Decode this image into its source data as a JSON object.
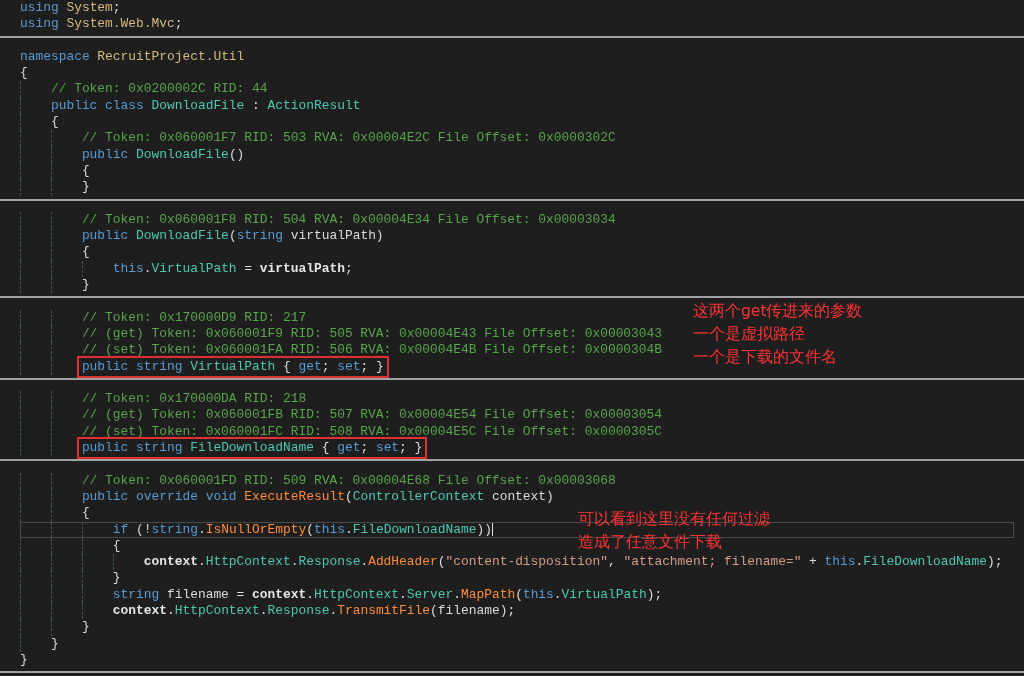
{
  "code_lines": [
    {
      "tokens": [
        {
          "text": "using",
          "kind": "keyword"
        },
        {
          "text": " System",
          "kind": "namespace"
        },
        {
          "text": ";",
          "kind": "plain"
        }
      ]
    },
    {
      "tokens": [
        {
          "text": "using",
          "kind": "keyword"
        },
        {
          "text": " System.Web.Mvc",
          "kind": "namespace"
        },
        {
          "text": ";",
          "kind": "plain"
        }
      ],
      "separator_after": true
    },
    {
      "tokens": [
        {
          "text": "namespace",
          "kind": "keyword"
        },
        {
          "text": " RecruitProject.Util",
          "kind": "namespace"
        }
      ]
    },
    {
      "tokens": [
        {
          "text": "{",
          "kind": "plain"
        }
      ]
    },
    {
      "tokens": [
        {
          "text": "    // Token: 0x0200002C RID: 44",
          "kind": "comment"
        }
      ]
    },
    {
      "tokens": [
        {
          "text": "    public class",
          "kind": "keyword"
        },
        {
          "text": " DownloadFile",
          "kind": "type"
        },
        {
          "text": " : ",
          "kind": "plain"
        },
        {
          "text": "ActionResult",
          "kind": "type"
        }
      ]
    },
    {
      "tokens": [
        {
          "text": "    {",
          "kind": "plain"
        }
      ]
    },
    {
      "tokens": [
        {
          "text": "        // Token: 0x060001F7 RID: 503 RVA: 0x00004E2C File Offset: 0x0000302C",
          "kind": "comment"
        }
      ]
    },
    {
      "tokens": [
        {
          "text": "        public",
          "kind": "keyword"
        },
        {
          "text": " DownloadFile",
          "kind": "type"
        },
        {
          "text": "()",
          "kind": "plain"
        }
      ]
    },
    {
      "tokens": [
        {
          "text": "        {",
          "kind": "plain"
        }
      ]
    },
    {
      "tokens": [
        {
          "text": "        }",
          "kind": "plain"
        }
      ],
      "separator_after": true
    },
    {
      "tokens": [
        {
          "text": "        // Token: 0x060001F8 RID: 504 RVA: 0x00004E34 File Offset: 0x00003034",
          "kind": "comment"
        }
      ]
    },
    {
      "tokens": [
        {
          "text": "        public",
          "kind": "keyword"
        },
        {
          "text": " DownloadFile",
          "kind": "type"
        },
        {
          "text": "(",
          "kind": "plain"
        },
        {
          "text": "string",
          "kind": "keyword"
        },
        {
          "text": " virtualPath)",
          "kind": "plain"
        }
      ]
    },
    {
      "tokens": [
        {
          "text": "        {",
          "kind": "plain"
        }
      ]
    },
    {
      "tokens": [
        {
          "text": "            this",
          "kind": "keyword"
        },
        {
          "text": ".",
          "kind": "plain"
        },
        {
          "text": "VirtualPath",
          "kind": "property"
        },
        {
          "text": " = ",
          "kind": "plain"
        },
        {
          "text": "virtualPath",
          "kind": "parameter"
        },
        {
          "text": ";",
          "kind": "plain"
        }
      ]
    },
    {
      "tokens": [
        {
          "text": "        }",
          "kind": "plain"
        }
      ],
      "separator_after": true
    },
    {
      "tokens": [
        {
          "text": "        // Token: 0x170000D9 RID: 217",
          "kind": "comment"
        }
      ]
    },
    {
      "tokens": [
        {
          "text": "        // (get) Token: 0x060001F9 RID: 505 RVA: 0x00004E43 File Offset: 0x00003043",
          "kind": "comment"
        }
      ]
    },
    {
      "tokens": [
        {
          "text": "        // (set) Token: 0x060001FA RID: 506 RVA: 0x00004E4B File Offset: 0x0000304B",
          "kind": "comment"
        }
      ]
    },
    {
      "tokens": [
        {
          "text": "        public string",
          "kind": "keyword"
        },
        {
          "text": " VirtualPath",
          "kind": "property"
        },
        {
          "text": " { ",
          "kind": "plain"
        },
        {
          "text": "get",
          "kind": "keyword"
        },
        {
          "text": "; ",
          "kind": "plain"
        },
        {
          "text": "set",
          "kind": "keyword"
        },
        {
          "text": "; }",
          "kind": "plain"
        }
      ],
      "boxed": true,
      "separator_after": true
    },
    {
      "tokens": [
        {
          "text": "        // Token: 0x170000DA RID: 218",
          "kind": "comment"
        }
      ]
    },
    {
      "tokens": [
        {
          "text": "        // (get) Token: 0x060001FB RID: 507 RVA: 0x00004E54 File Offset: 0x00003054",
          "kind": "comment"
        }
      ]
    },
    {
      "tokens": [
        {
          "text": "        // (set) Token: 0x060001FC RID: 508 RVA: 0x00004E5C File Offset: 0x0000305C",
          "kind": "comment"
        }
      ]
    },
    {
      "tokens": [
        {
          "text": "        public string",
          "kind": "keyword"
        },
        {
          "text": " FileDownloadName",
          "kind": "property"
        },
        {
          "text": " { ",
          "kind": "plain"
        },
        {
          "text": "get",
          "kind": "keyword"
        },
        {
          "text": "; ",
          "kind": "plain"
        },
        {
          "text": "set",
          "kind": "keyword"
        },
        {
          "text": "; }",
          "kind": "plain"
        }
      ],
      "boxed": true,
      "separator_after": true
    },
    {
      "tokens": [
        {
          "text": "        // Token: 0x060001FD RID: 509 RVA: 0x00004E68 File Offset: 0x00003068",
          "kind": "comment"
        }
      ]
    },
    {
      "tokens": [
        {
          "text": "        public override void",
          "kind": "keyword"
        },
        {
          "text": " ExecuteResult",
          "kind": "method"
        },
        {
          "text": "(",
          "kind": "plain"
        },
        {
          "text": "ControllerContext",
          "kind": "type"
        },
        {
          "text": " context)",
          "kind": "plain"
        }
      ]
    },
    {
      "tokens": [
        {
          "text": "        {",
          "kind": "plain"
        }
      ]
    },
    {
      "tokens": [
        {
          "text": "            if",
          "kind": "keyword"
        },
        {
          "text": " (!",
          "kind": "plain"
        },
        {
          "text": "string",
          "kind": "keyword"
        },
        {
          "text": ".",
          "kind": "plain"
        },
        {
          "text": "IsNullOrEmpty",
          "kind": "method"
        },
        {
          "text": "(",
          "kind": "plain"
        },
        {
          "text": "this",
          "kind": "keyword"
        },
        {
          "text": ".",
          "kind": "plain"
        },
        {
          "text": "FileDownloadName",
          "kind": "property"
        },
        {
          "text": "))",
          "kind": "plain"
        }
      ],
      "current": true
    },
    {
      "tokens": [
        {
          "text": "            {",
          "kind": "plain"
        }
      ]
    },
    {
      "tokens": [
        {
          "text": "                context",
          "kind": "parameter"
        },
        {
          "text": ".",
          "kind": "plain"
        },
        {
          "text": "HttpContext",
          "kind": "property"
        },
        {
          "text": ".",
          "kind": "plain"
        },
        {
          "text": "Response",
          "kind": "property"
        },
        {
          "text": ".",
          "kind": "plain"
        },
        {
          "text": "AddHeader",
          "kind": "method"
        },
        {
          "text": "(",
          "kind": "plain"
        },
        {
          "text": "\"content-disposition\"",
          "kind": "string"
        },
        {
          "text": ", ",
          "kind": "plain"
        },
        {
          "text": "\"attachment; filename=\"",
          "kind": "string"
        },
        {
          "text": " + ",
          "kind": "plain"
        },
        {
          "text": "this",
          "kind": "keyword"
        },
        {
          "text": ".",
          "kind": "plain"
        },
        {
          "text": "FileDownloadName",
          "kind": "property"
        },
        {
          "text": ");",
          "kind": "plain"
        }
      ]
    },
    {
      "tokens": [
        {
          "text": "            }",
          "kind": "plain"
        }
      ]
    },
    {
      "tokens": [
        {
          "text": "            string",
          "kind": "keyword"
        },
        {
          "text": " filename = ",
          "kind": "plain"
        },
        {
          "text": "context",
          "kind": "parameter"
        },
        {
          "text": ".",
          "kind": "plain"
        },
        {
          "text": "HttpContext",
          "kind": "property"
        },
        {
          "text": ".",
          "kind": "plain"
        },
        {
          "text": "Server",
          "kind": "property"
        },
        {
          "text": ".",
          "kind": "plain"
        },
        {
          "text": "MapPath",
          "kind": "method"
        },
        {
          "text": "(",
          "kind": "plain"
        },
        {
          "text": "this",
          "kind": "keyword"
        },
        {
          "text": ".",
          "kind": "plain"
        },
        {
          "text": "VirtualPath",
          "kind": "property"
        },
        {
          "text": ");",
          "kind": "plain"
        }
      ]
    },
    {
      "tokens": [
        {
          "text": "            context",
          "kind": "parameter"
        },
        {
          "text": ".",
          "kind": "plain"
        },
        {
          "text": "HttpContext",
          "kind": "property"
        },
        {
          "text": ".",
          "kind": "plain"
        },
        {
          "text": "Response",
          "kind": "property"
        },
        {
          "text": ".",
          "kind": "plain"
        },
        {
          "text": "TransmitFile",
          "kind": "method"
        },
        {
          "text": "(filename);",
          "kind": "plain"
        }
      ]
    },
    {
      "tokens": [
        {
          "text": "        }",
          "kind": "plain"
        }
      ]
    },
    {
      "tokens": [
        {
          "text": "    }",
          "kind": "plain"
        }
      ]
    },
    {
      "tokens": [
        {
          "text": "}",
          "kind": "plain"
        }
      ],
      "separator_after": true
    }
  ],
  "annotations": [
    {
      "lines": [
        "这两个get传进来的参数",
        "一个是虚拟路径",
        "一个是下载的文件名"
      ]
    },
    {
      "lines": [
        "可以看到这里没有任何过滤",
        "造成了任意文件下载"
      ]
    }
  ]
}
